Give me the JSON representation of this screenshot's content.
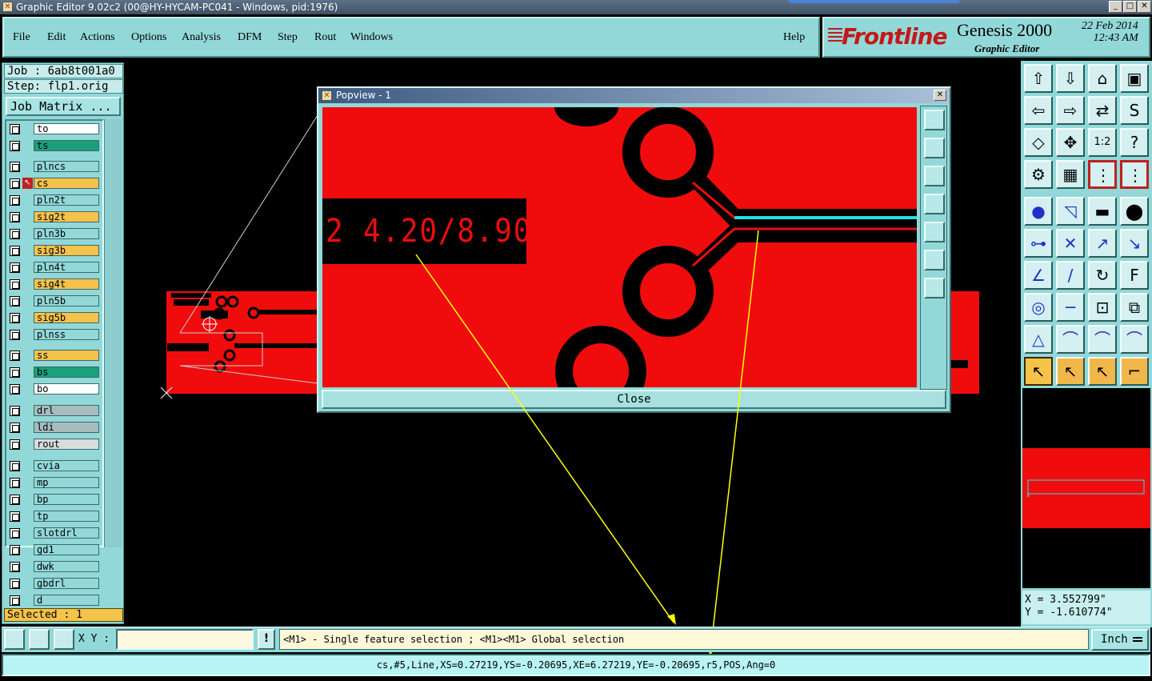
{
  "window": {
    "title": "Graphic Editor 9.02c2 (00@HY-HYCAM-PC041 - Windows, pid:1976)",
    "buttons": [
      "_",
      "□",
      "✕"
    ]
  },
  "menu": {
    "items": [
      "File",
      "Edit",
      "Actions",
      "Options",
      "Analysis",
      "DFM",
      "Step",
      "Rout",
      "Windows"
    ],
    "help": "Help"
  },
  "brand": {
    "logo": "Frontline",
    "product": "Genesis 2000",
    "subtitle": "Graphic Editor",
    "date": "22 Feb 2014",
    "time": "12:43 AM"
  },
  "job": {
    "job_label": "Job : 6ab8t001a0",
    "step_label": "Step: flp1.orig",
    "matrix_button": "Job Matrix ..."
  },
  "layers": [
    {
      "name": "to",
      "color": "#ffffff"
    },
    {
      "name": "ts",
      "color": "#1aa07a"
    },
    {
      "name": "plncs",
      "color": "#93d8d8"
    },
    {
      "name": "cs",
      "color": "#f5c24a",
      "active": true
    },
    {
      "name": "pln2t",
      "color": "#93d8d8"
    },
    {
      "name": "sig2t",
      "color": "#f5c24a"
    },
    {
      "name": "pln3b",
      "color": "#93d8d8"
    },
    {
      "name": "sig3b",
      "color": "#f5c24a"
    },
    {
      "name": "pln4t",
      "color": "#93d8d8"
    },
    {
      "name": "sig4t",
      "color": "#f5c24a"
    },
    {
      "name": "pln5b",
      "color": "#93d8d8"
    },
    {
      "name": "sig5b",
      "color": "#f5c24a"
    },
    {
      "name": "plnss",
      "color": "#93d8d8"
    },
    {
      "name": "ss",
      "color": "#f5c24a"
    },
    {
      "name": "bs",
      "color": "#1aa07a"
    },
    {
      "name": "bo",
      "color": "#ffffff"
    },
    {
      "name": "drl",
      "color": "#a8bcc0"
    },
    {
      "name": "ldi",
      "color": "#a8bcc0"
    },
    {
      "name": "rout",
      "color": "#d8dcdc"
    },
    {
      "name": "cvia",
      "color": "#93d8d8"
    },
    {
      "name": "mp",
      "color": "#93d8d8"
    },
    {
      "name": "bp",
      "color": "#93d8d8"
    },
    {
      "name": "tp",
      "color": "#93d8d8"
    },
    {
      "name": "slotdrl",
      "color": "#93d8d8"
    },
    {
      "name": "gd1",
      "color": "#93d8d8"
    },
    {
      "name": "dwk",
      "color": "#93d8d8"
    },
    {
      "name": "gbdrl",
      "color": "#93d8d8"
    },
    {
      "name": "d",
      "color": "#93d8d8"
    }
  ],
  "selected_label": "Selected : 1",
  "popview": {
    "title": "Popview - 1",
    "feature_text": "2 4.20/8.90",
    "close_label": "Close"
  },
  "coords": {
    "x": "X =  3.552799\"",
    "y": "Y = -1.610774\""
  },
  "cmd": {
    "xy_label": "X Y :",
    "xy_value": "",
    "bang": "!",
    "hint": "<M1> - Single feature selection ; <M1><M1> Global selection",
    "unit": "Inch"
  },
  "status": "cs,#5,Line,XS=0.27219,YS=-0.20695,XE=6.27219,YE=-0.20695,r5,POS,Ang=0",
  "colors": {
    "copper": "#f00c0c",
    "panel": "#93d8d8",
    "highlight": "#22e0e8",
    "annotation": "#ffff00"
  }
}
